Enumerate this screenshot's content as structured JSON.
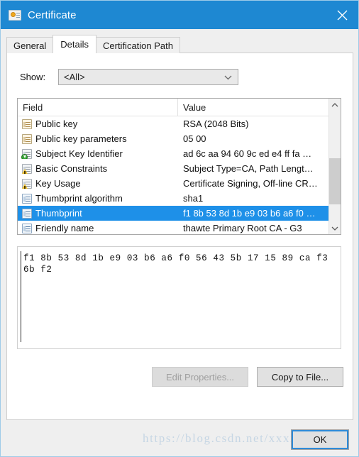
{
  "window": {
    "title": "Certificate",
    "icon": "certificate-icon",
    "close_label": "✕",
    "accent_color": "#1e88d2",
    "selection_color": "#1e90e8"
  },
  "tabs": [
    {
      "label": "General",
      "active": false
    },
    {
      "label": "Details",
      "active": true
    },
    {
      "label": "Certification Path",
      "active": false
    }
  ],
  "show": {
    "label": "Show:",
    "value": "<All>",
    "arrow_icon": "chevron-down-icon"
  },
  "list": {
    "columns": {
      "field": "Field",
      "value": "Value"
    },
    "rows": [
      {
        "field": "Public key",
        "value": "RSA (2048 Bits)",
        "icon": "field-tan-icon",
        "selected": false
      },
      {
        "field": "Public key parameters",
        "value": "05 00",
        "icon": "field-tan-icon",
        "selected": false
      },
      {
        "field": "Subject Key Identifier",
        "value": "ad 6c aa 94 60 9c ed e4 ff fa …",
        "icon": "field-gray-download-icon",
        "selected": false
      },
      {
        "field": "Basic Constraints",
        "value": "Subject Type=CA, Path Lengt…",
        "icon": "field-gray-warning-icon",
        "selected": false
      },
      {
        "field": "Key Usage",
        "value": "Certificate Signing, Off-line CR…",
        "icon": "field-gray-warning-icon",
        "selected": false
      },
      {
        "field": "Thumbprint algorithm",
        "value": "sha1",
        "icon": "field-blue-icon",
        "selected": false
      },
      {
        "field": "Thumbprint",
        "value": "f1 8b 53 8d 1b e9 03 b6 a6 f0 …",
        "icon": "field-blue-icon",
        "selected": true
      },
      {
        "field": "Friendly name",
        "value": "thawte Primary Root CA - G3",
        "icon": "field-blue-icon",
        "selected": false
      }
    ],
    "scrollbar": {
      "up_icon": "chevron-up-icon",
      "down_icon": "chevron-down-icon"
    }
  },
  "detail": {
    "text": "f1 8b 53 8d 1b e9 03 b6 a6 f0 56 43 5b 17 15 89 ca f3 6b f2"
  },
  "actions": {
    "edit_properties": "Edit Properties...",
    "copy_to_file": "Copy to File..."
  },
  "footer": {
    "ok": "OK",
    "watermark": "https://blog.csdn.net/xxxxxxx"
  }
}
